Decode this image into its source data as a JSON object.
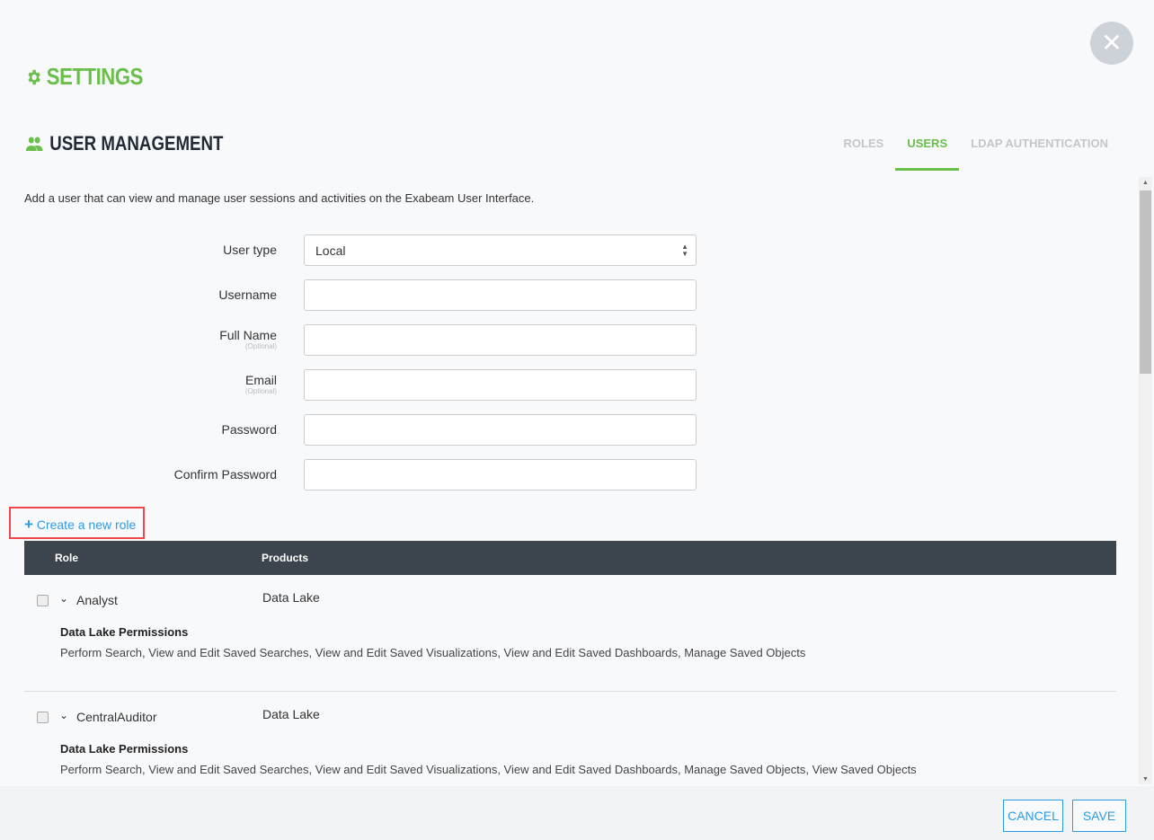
{
  "header": {
    "title": "SETTINGS",
    "close_icon": "close-icon"
  },
  "section": {
    "title": "USER MANAGEMENT",
    "tabs": [
      {
        "label": "ROLES",
        "active": false
      },
      {
        "label": "USERS",
        "active": true
      },
      {
        "label": "LDAP AUTHENTICATION",
        "active": false
      }
    ]
  },
  "description": "Add a user that can view and manage user sessions and activities on the Exabeam User Interface.",
  "form": {
    "user_type": {
      "label": "User type",
      "value": "Local"
    },
    "username": {
      "label": "Username",
      "value": ""
    },
    "full_name": {
      "label": "Full Name",
      "hint": "(Optional)",
      "value": ""
    },
    "email": {
      "label": "Email",
      "hint": "(Optional)",
      "value": ""
    },
    "password": {
      "label": "Password",
      "value": ""
    },
    "confirm_password": {
      "label": "Confirm Password",
      "value": ""
    }
  },
  "create_role": {
    "icon": "+",
    "label": "Create a new role"
  },
  "table": {
    "headers": [
      "Role",
      "Products"
    ],
    "rows": [
      {
        "role": "Analyst",
        "products": "Data Lake",
        "perm_title": "Data Lake Permissions",
        "permissions": "Perform Search, View and Edit Saved Searches, View and Edit Saved Visualizations, View and Edit Saved Dashboards, Manage Saved Objects"
      },
      {
        "role": "CentralAuditor",
        "products": "Data Lake",
        "perm_title": "Data Lake Permissions",
        "permissions": "Perform Search, View and Edit Saved Searches, View and Edit Saved Visualizations, View and Edit Saved Dashboards, Manage Saved Objects, View Saved Objects"
      }
    ]
  },
  "footer": {
    "cancel": "CANCEL",
    "save": "SAVE"
  },
  "colors": {
    "accent": "#6abf4b",
    "link": "#2e9be6",
    "highlight": "#f0474b",
    "table_header": "#3c444d"
  }
}
